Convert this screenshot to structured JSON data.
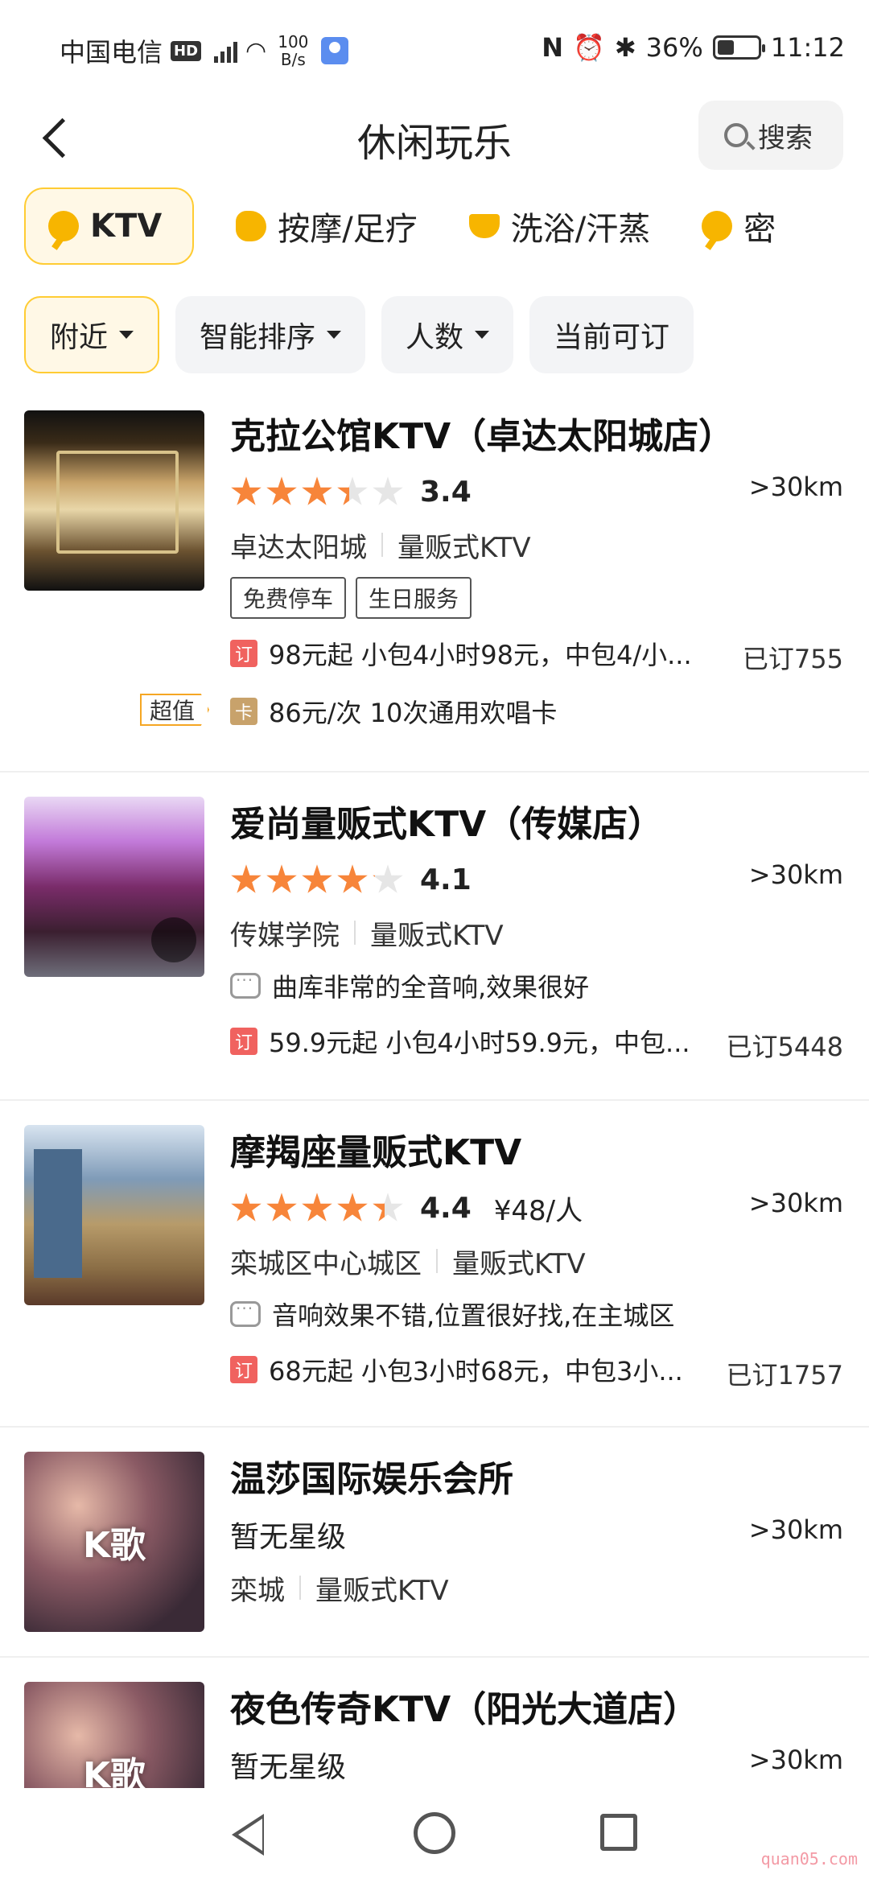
{
  "status_bar": {
    "carrier": "中国电信",
    "hd": "HD",
    "net_speed_value": "100",
    "net_speed_unit": "B/s",
    "battery": "36%",
    "time": "11:12"
  },
  "header": {
    "title": "休闲玩乐",
    "search_label": "搜索"
  },
  "categories": [
    {
      "label": "KTV",
      "icon": "key-icon",
      "active": true
    },
    {
      "label": "按摩/足疗",
      "icon": "foot-icon",
      "active": false
    },
    {
      "label": "洗浴/汗蒸",
      "icon": "bath-icon",
      "active": false
    },
    {
      "label": "密",
      "icon": "key-icon",
      "active": false
    }
  ],
  "filters": [
    {
      "label": "附近",
      "dropdown": true,
      "active": true
    },
    {
      "label": "智能排序",
      "dropdown": true,
      "active": false
    },
    {
      "label": "人数",
      "dropdown": true,
      "active": false
    },
    {
      "label": "当前可订",
      "dropdown": false,
      "active": false
    }
  ],
  "shops": [
    {
      "name": "克拉公馆KTV（卓达太阳城店）",
      "rating": 3.4,
      "score": "3.4",
      "distance": ">30km",
      "area": "卓达太阳城",
      "type": "量贩式KTV",
      "labels": [
        "免费停车",
        "生日服务"
      ],
      "deal_icon": "订",
      "deal": "98元起 小包4小时98元，中包4/小...",
      "sold": "已订755",
      "card_badge": "超值",
      "card_icon": "卡",
      "card_deal": "86元/次 10次通用欢唱卡"
    },
    {
      "name": "爱尚量贩式KTV（传媒店）",
      "rating": 4.1,
      "score": "4.1",
      "distance": ">30km",
      "area": "传媒学院",
      "type": "量贩式KTV",
      "review": "曲库非常的全音响,效果很好",
      "deal_icon": "订",
      "deal": "59.9元起 小包4小时59.9元，中包...",
      "sold": "已订5448"
    },
    {
      "name": "摩羯座量贩式KTV",
      "rating": 4.4,
      "score": "4.4",
      "price_per": "¥48/人",
      "distance": ">30km",
      "area": "栾城区中心城区",
      "type": "量贩式KTV",
      "review": "音响效果不错,位置很好找,在主城区",
      "deal_icon": "订",
      "deal": "68元起 小包3小时68元，中包3小...",
      "sold": "已订1757"
    },
    {
      "name": "温莎国际娱乐会所",
      "rating_text": "暂无星级",
      "distance": ">30km",
      "area": "栾城",
      "type": "量贩式KTV",
      "thumb_text": "K歌"
    },
    {
      "name": "夜色传奇KTV（阳光大道店）",
      "rating_text": "暂无星级",
      "distance": ">30km",
      "thumb_text": "K歌"
    }
  ],
  "watermark": "quan05.com",
  "colors": {
    "accent_yellow": "#ffcc33",
    "star_orange": "#f7853a",
    "star_empty": "#e6e6e6",
    "deal_red": "#f0625f",
    "card_gold": "#c8a26b"
  }
}
